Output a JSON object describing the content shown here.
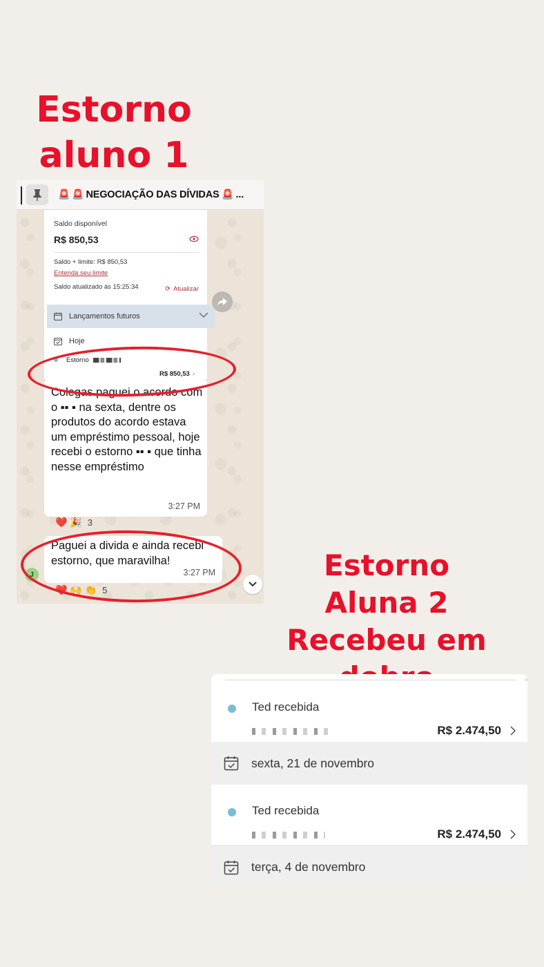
{
  "headline_1": {
    "line1": "Estorno",
    "line2": "aluno 1"
  },
  "headline_2": {
    "line1": "Estorno",
    "line2": "Aluna 2",
    "line3": "Recebeu em dobro"
  },
  "chat": {
    "pinned_title": "NEGOCIAÇÃO DAS DÍVIDAS",
    "pinned_ellipsis": "...",
    "bank_card": {
      "balance_label": "Saldo disponível",
      "balance_value": "R$ 850,53",
      "limit_text": "Saldo + limite: R$ 850,53",
      "limit_link": "Entenda seu limite",
      "updated_text": "Saldo atualizado às 15:25:34",
      "refresh_label": "Atualizar",
      "future_label": "Lançamentos futuros",
      "today_label": "Hoje",
      "refund_label": "Estorno",
      "refund_value": "R$ 850,53"
    },
    "messages": [
      {
        "text": "Colegas paguei o acordo com o ▪▪ ▪ na sexta, dentre os produtos do acordo estava um empréstimo pessoal, hoje recebi o estorno ▪▪ ▪ que tinha nesse empréstimo",
        "time": "3:27 PM",
        "reactions": "❤️ 🎉",
        "reaction_count": "3"
      },
      {
        "text": "Paguei a divida e ainda recebi estorno, que maravilha!",
        "time": "3:27 PM",
        "reactions": "❤️ 🙌 👏",
        "reaction_count": "5",
        "avatar_initial": "J"
      }
    ]
  },
  "transactions": {
    "items": [
      {
        "type": "Ted recebida",
        "amount": "R$ 2.474,50"
      },
      {
        "type": "Ted recebida",
        "amount": "R$ 2.474,50"
      }
    ],
    "dates": [
      "sexta, 21 de novembro",
      "terça, 4 de novembro"
    ]
  },
  "colors": {
    "headline": "#e8102a",
    "ring": "#e5202e",
    "accent_teal": "#78bfd0",
    "link": "#b0303a"
  }
}
